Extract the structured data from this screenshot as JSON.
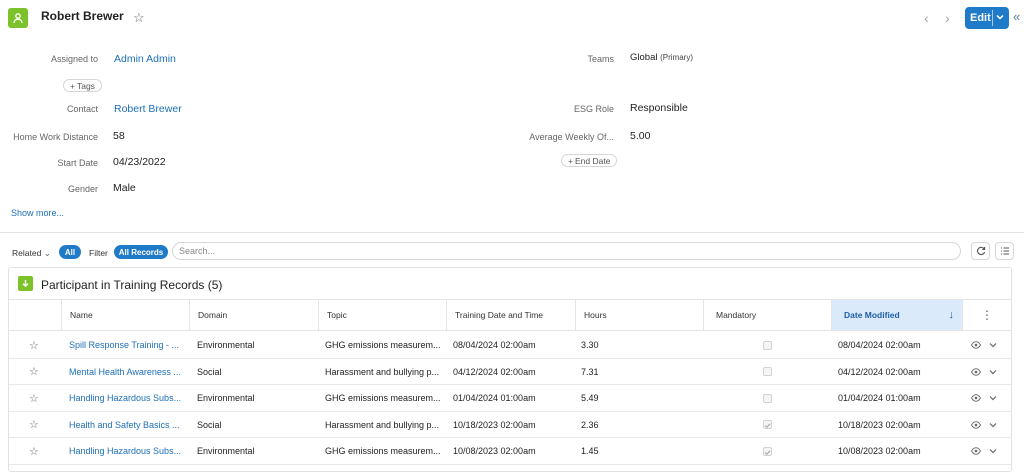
{
  "header": {
    "title": "Robert Brewer",
    "edit_label": "Edit"
  },
  "fields": {
    "assigned_to_label": "Assigned to",
    "assigned_to_value": "Admin Admin",
    "teams_label": "Teams",
    "teams_value": "Global",
    "teams_primary": "(Primary)",
    "tags_label": "Tags",
    "contact_label": "Contact",
    "contact_value": "Robert Brewer",
    "esg_role_label": "ESG Role",
    "esg_role_value": "Responsible",
    "home_work_distance_label": "Home Work Distance",
    "home_work_distance_value": "58",
    "avg_weekly_label": "Average Weekly Of...",
    "avg_weekly_value": "5.00",
    "start_date_label": "Start Date",
    "start_date_value": "04/23/2022",
    "end_date_label": "End Date",
    "gender_label": "Gender",
    "gender_value": "Male",
    "show_more": "Show more..."
  },
  "related_bar": {
    "related_label": "Related",
    "all_label": "All",
    "filter_label": "Filter",
    "all_records_label": "All Records",
    "search_placeholder": "Search..."
  },
  "panel": {
    "title": "Participant in Training Records",
    "count": "(5)",
    "columns": [
      "Name",
      "Domain",
      "Topic",
      "Training Date and Time",
      "Hours",
      "Mandatory",
      "Date Modified"
    ],
    "rows": [
      {
        "name": "Spill Response Training - ...",
        "domain": "Environmental",
        "topic": "GHG emissions measurem...",
        "training_date": "08/04/2024 02:00am",
        "hours": "3.30",
        "mandatory": false,
        "date_modified": "08/04/2024 02:00am"
      },
      {
        "name": "Mental Health Awareness ...",
        "domain": "Social",
        "topic": "Harassment and bullying p...",
        "training_date": "04/12/2024 02:00am",
        "hours": "7.31",
        "mandatory": false,
        "date_modified": "04/12/2024 02:00am"
      },
      {
        "name": "Handling Hazardous Subs...",
        "domain": "Environmental",
        "topic": "GHG emissions measurem...",
        "training_date": "01/04/2024 01:00am",
        "hours": "5.49",
        "mandatory": false,
        "date_modified": "01/04/2024 01:00am"
      },
      {
        "name": "Health and Safety Basics ...",
        "domain": "Social",
        "topic": "Harassment and bullying p...",
        "training_date": "10/18/2023 02:00am",
        "hours": "2.36",
        "mandatory": true,
        "date_modified": "10/18/2023 02:00am"
      },
      {
        "name": "Handling Hazardous Subs...",
        "domain": "Environmental",
        "topic": "GHG emissions measurem...",
        "training_date": "10/08/2023 02:00am",
        "hours": "1.45",
        "mandatory": true,
        "date_modified": "10/08/2023 02:00am"
      }
    ]
  },
  "colors": {
    "accent": "#1f7bc8",
    "link": "#1d6fb8",
    "entity_icon": "#7cc22a"
  }
}
